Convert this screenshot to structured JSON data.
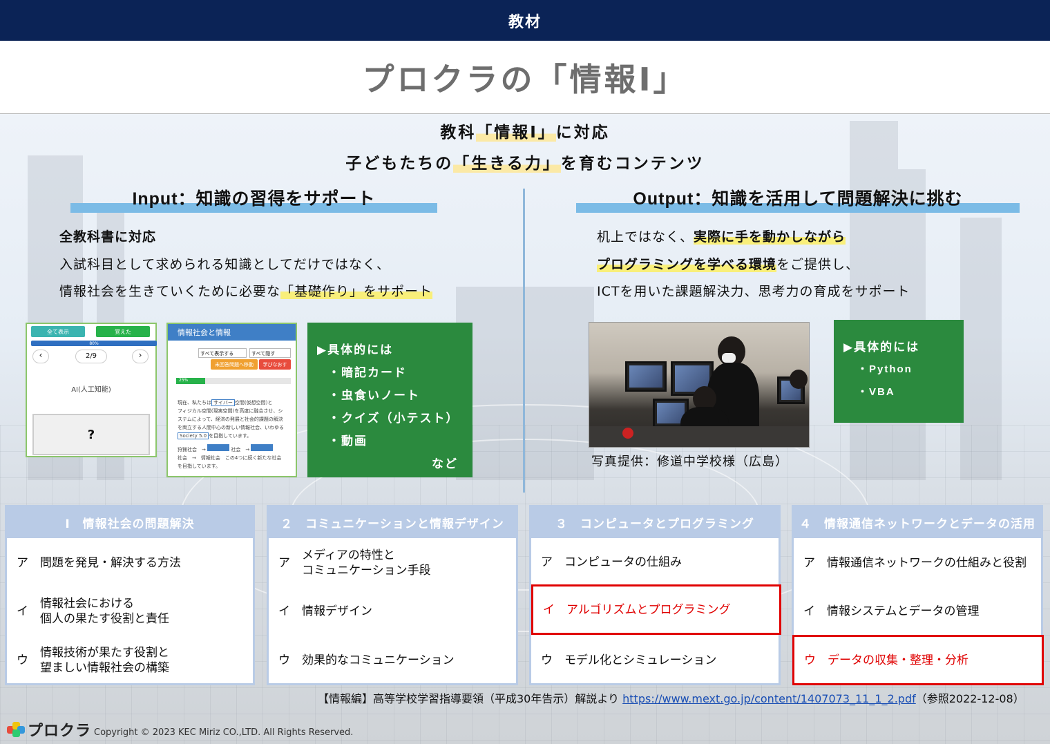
{
  "header": {
    "category": "教材",
    "title": "プロクラの「情報Ⅰ」"
  },
  "subtitle": {
    "line1_pre": "教科",
    "line1_hl": "「情報Ⅰ」",
    "line1_post": "に対応",
    "line2_pre": "子どもたちの",
    "line2_hl": "「生きる力」",
    "line2_post": "を育むコンテンツ"
  },
  "input": {
    "heading_bold": "Input",
    "heading_rest": "：知識の習得をサポート",
    "line1": "全教科書に対応",
    "line2": "入試科目として求められる知識としてだけではなく、",
    "line3_pre": "情報社会を生きていくために必要な",
    "line3_hl": "「基礎作り」をサポート",
    "examples_title": "▶具体的には",
    "examples": [
      "・暗記カード",
      "・虫食いノート",
      "・クイズ（小テスト）",
      "・動画"
    ],
    "examples_more": "など",
    "card_app": {
      "btn_show_all": "全て表示",
      "btn_memorized": "覚えた",
      "progress": "80%",
      "page": "2/9",
      "prev": "‹",
      "next": "›",
      "term": "AI(人工知能)",
      "answer": "?"
    },
    "note_app": {
      "title": "情報社会と情報",
      "btn_show_all": "すべて表示する",
      "btn_hide_all": "すべて隠す",
      "btn_move_unsolved": "未回答問題へ移動",
      "btn_redo": "学びなおす",
      "progress": "25%",
      "body_1": "現在、私たちは",
      "blank_1": "サイバー",
      "body_2": "空間(仮想空間)と",
      "body_3": "フィジカル空間(現実空間)を高度に融合させ、シ",
      "body_4": "ステムによって、経済の発展と社会的課題の解決",
      "body_5": "を両立する人間中心の新しい情報社会、いわゆる",
      "blank_2": "Society 5.0",
      "body_6": "を目指しています。",
      "body_7": "狩猟社会　→",
      "body_8": "社会　→",
      "body_9": "社会　→　情報社会　この4つに続く新たな社会",
      "body_10": "を目指しています。"
    }
  },
  "output": {
    "heading_bold": "Output",
    "heading_rest": "：知識を活用して問題解決に挑む",
    "line1_pre": "机上ではなく、",
    "line1_hl": "実際に手を動かしながら",
    "line2_hl": "プログラミングを学べる環境",
    "line2_post": "をご提供し、",
    "line3": "ICTを用いた課題解決力、思考力の育成をサポート",
    "examples_title": "▶具体的には",
    "examples": [
      "・Python",
      "・VBA"
    ],
    "photo_caption": "写真提供：修道中学校様（広島）"
  },
  "categories": [
    {
      "title": "Ⅰ　情報社会の問題解決",
      "items": [
        {
          "k": "ア",
          "line1": "問題を発見・解決する方法",
          "line2": "",
          "highlight": false
        },
        {
          "k": "イ",
          "line1": "情報社会における",
          "line2": "個人の果たす役割と責任",
          "highlight": false
        },
        {
          "k": "ウ",
          "line1": "情報技術が果たす役割と",
          "line2": "望ましい情報社会の構築",
          "highlight": false
        }
      ]
    },
    {
      "title": "２　コミュニケーションと情報デザイン",
      "items": [
        {
          "k": "ア",
          "line1": "メディアの特性と",
          "line2": "コミュニケーション手段",
          "highlight": false
        },
        {
          "k": "イ",
          "line1": "情報デザイン",
          "line2": "",
          "highlight": false
        },
        {
          "k": "ウ",
          "line1": "効果的なコミュニケーション",
          "line2": "",
          "highlight": false
        }
      ]
    },
    {
      "title": "３　コンピュータとプログラミング",
      "items": [
        {
          "k": "ア",
          "line1": "コンピュータの仕組み",
          "line2": "",
          "highlight": false
        },
        {
          "k": "イ",
          "line1": "アルゴリズムとプログラミング",
          "line2": "",
          "highlight": true
        },
        {
          "k": "ウ",
          "line1": "モデル化とシミュレーション",
          "line2": "",
          "highlight": false
        }
      ]
    },
    {
      "title": "４　情報通信ネットワークとデータの活用",
      "items": [
        {
          "k": "ア",
          "line1": "情報通信ネットワークの仕組みと役割",
          "line2": "",
          "highlight": false
        },
        {
          "k": "イ",
          "line1": "情報システムとデータの管理",
          "line2": "",
          "highlight": false
        },
        {
          "k": "ウ",
          "line1": "データの収集・整理・分析",
          "line2": "",
          "highlight": true
        }
      ]
    }
  ],
  "reference": {
    "text": "【情報編】高等学校学習指導要領（平成30年告示）解説より",
    "url": "https://www.mext.go.jp/content/1407073_11_1_2.pdf",
    "suffix": "（参照2022-12-08）"
  },
  "footer": {
    "logo": "プロクラ",
    "copyright": "Copyright © 2023 KEC Miriz CO.,LTD. All Rights Reserved."
  },
  "colors": {
    "topbar": "#0b2356",
    "accent_blue": "#7bbbe6",
    "green": "#2b8a3e",
    "card_head": "#b9cbe6",
    "highlight_red": "#e00000"
  }
}
